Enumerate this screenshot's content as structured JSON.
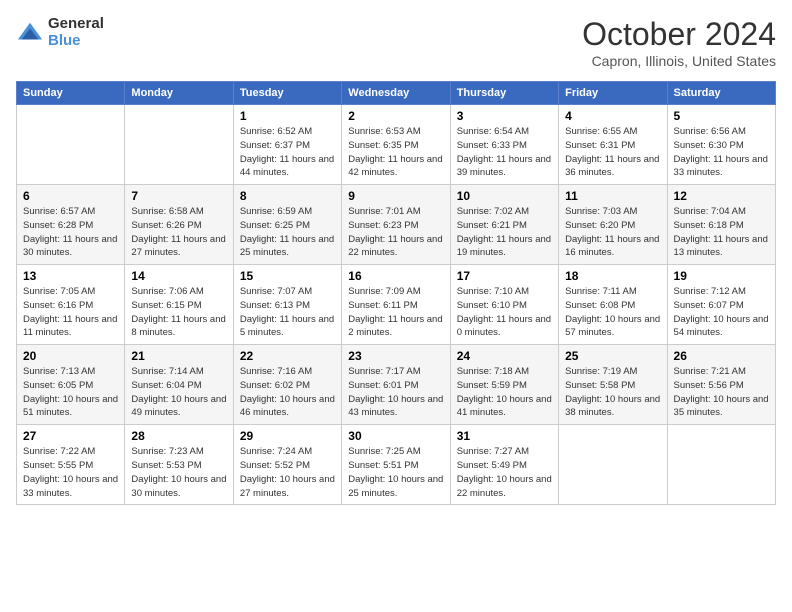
{
  "logo": {
    "general": "General",
    "blue": "Blue"
  },
  "title": "October 2024",
  "location": "Capron, Illinois, United States",
  "days_of_week": [
    "Sunday",
    "Monday",
    "Tuesday",
    "Wednesday",
    "Thursday",
    "Friday",
    "Saturday"
  ],
  "weeks": [
    [
      {
        "day": "",
        "info": ""
      },
      {
        "day": "",
        "info": ""
      },
      {
        "day": "1",
        "info": "Sunrise: 6:52 AM\nSunset: 6:37 PM\nDaylight: 11 hours and 44 minutes."
      },
      {
        "day": "2",
        "info": "Sunrise: 6:53 AM\nSunset: 6:35 PM\nDaylight: 11 hours and 42 minutes."
      },
      {
        "day": "3",
        "info": "Sunrise: 6:54 AM\nSunset: 6:33 PM\nDaylight: 11 hours and 39 minutes."
      },
      {
        "day": "4",
        "info": "Sunrise: 6:55 AM\nSunset: 6:31 PM\nDaylight: 11 hours and 36 minutes."
      },
      {
        "day": "5",
        "info": "Sunrise: 6:56 AM\nSunset: 6:30 PM\nDaylight: 11 hours and 33 minutes."
      }
    ],
    [
      {
        "day": "6",
        "info": "Sunrise: 6:57 AM\nSunset: 6:28 PM\nDaylight: 11 hours and 30 minutes."
      },
      {
        "day": "7",
        "info": "Sunrise: 6:58 AM\nSunset: 6:26 PM\nDaylight: 11 hours and 27 minutes."
      },
      {
        "day": "8",
        "info": "Sunrise: 6:59 AM\nSunset: 6:25 PM\nDaylight: 11 hours and 25 minutes."
      },
      {
        "day": "9",
        "info": "Sunrise: 7:01 AM\nSunset: 6:23 PM\nDaylight: 11 hours and 22 minutes."
      },
      {
        "day": "10",
        "info": "Sunrise: 7:02 AM\nSunset: 6:21 PM\nDaylight: 11 hours and 19 minutes."
      },
      {
        "day": "11",
        "info": "Sunrise: 7:03 AM\nSunset: 6:20 PM\nDaylight: 11 hours and 16 minutes."
      },
      {
        "day": "12",
        "info": "Sunrise: 7:04 AM\nSunset: 6:18 PM\nDaylight: 11 hours and 13 minutes."
      }
    ],
    [
      {
        "day": "13",
        "info": "Sunrise: 7:05 AM\nSunset: 6:16 PM\nDaylight: 11 hours and 11 minutes."
      },
      {
        "day": "14",
        "info": "Sunrise: 7:06 AM\nSunset: 6:15 PM\nDaylight: 11 hours and 8 minutes."
      },
      {
        "day": "15",
        "info": "Sunrise: 7:07 AM\nSunset: 6:13 PM\nDaylight: 11 hours and 5 minutes."
      },
      {
        "day": "16",
        "info": "Sunrise: 7:09 AM\nSunset: 6:11 PM\nDaylight: 11 hours and 2 minutes."
      },
      {
        "day": "17",
        "info": "Sunrise: 7:10 AM\nSunset: 6:10 PM\nDaylight: 11 hours and 0 minutes."
      },
      {
        "day": "18",
        "info": "Sunrise: 7:11 AM\nSunset: 6:08 PM\nDaylight: 10 hours and 57 minutes."
      },
      {
        "day": "19",
        "info": "Sunrise: 7:12 AM\nSunset: 6:07 PM\nDaylight: 10 hours and 54 minutes."
      }
    ],
    [
      {
        "day": "20",
        "info": "Sunrise: 7:13 AM\nSunset: 6:05 PM\nDaylight: 10 hours and 51 minutes."
      },
      {
        "day": "21",
        "info": "Sunrise: 7:14 AM\nSunset: 6:04 PM\nDaylight: 10 hours and 49 minutes."
      },
      {
        "day": "22",
        "info": "Sunrise: 7:16 AM\nSunset: 6:02 PM\nDaylight: 10 hours and 46 minutes."
      },
      {
        "day": "23",
        "info": "Sunrise: 7:17 AM\nSunset: 6:01 PM\nDaylight: 10 hours and 43 minutes."
      },
      {
        "day": "24",
        "info": "Sunrise: 7:18 AM\nSunset: 5:59 PM\nDaylight: 10 hours and 41 minutes."
      },
      {
        "day": "25",
        "info": "Sunrise: 7:19 AM\nSunset: 5:58 PM\nDaylight: 10 hours and 38 minutes."
      },
      {
        "day": "26",
        "info": "Sunrise: 7:21 AM\nSunset: 5:56 PM\nDaylight: 10 hours and 35 minutes."
      }
    ],
    [
      {
        "day": "27",
        "info": "Sunrise: 7:22 AM\nSunset: 5:55 PM\nDaylight: 10 hours and 33 minutes."
      },
      {
        "day": "28",
        "info": "Sunrise: 7:23 AM\nSunset: 5:53 PM\nDaylight: 10 hours and 30 minutes."
      },
      {
        "day": "29",
        "info": "Sunrise: 7:24 AM\nSunset: 5:52 PM\nDaylight: 10 hours and 27 minutes."
      },
      {
        "day": "30",
        "info": "Sunrise: 7:25 AM\nSunset: 5:51 PM\nDaylight: 10 hours and 25 minutes."
      },
      {
        "day": "31",
        "info": "Sunrise: 7:27 AM\nSunset: 5:49 PM\nDaylight: 10 hours and 22 minutes."
      },
      {
        "day": "",
        "info": ""
      },
      {
        "day": "",
        "info": ""
      }
    ]
  ]
}
